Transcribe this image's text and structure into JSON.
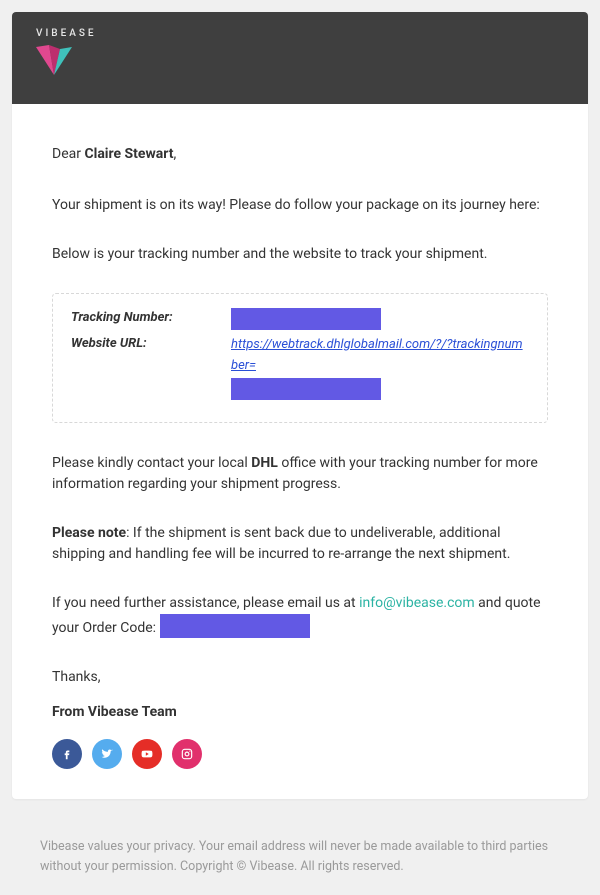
{
  "brand": {
    "name": "VIBEASE"
  },
  "greeting": {
    "prefix": "Dear ",
    "name": "Claire Stewart",
    "suffix": ","
  },
  "paragraphs": {
    "intro": "Your shipment is on its way! Please do follow your package on its journey here:",
    "tracking_intro": "Below is your tracking number and the website to track your shipment."
  },
  "tracking": {
    "number_label": "Tracking Number:",
    "url_label": "Website URL:",
    "url_text": "https://webtrack.dhlglobalmail.com/?/?trackingnumber="
  },
  "contact_dhl": {
    "pre": "Please kindly contact your local ",
    "bold": "DHL",
    "post": " office with your tracking number for more information regarding your shipment progress."
  },
  "note": {
    "label": "Please note",
    "text": ": If the shipment is sent back due to undeliverable, additional shipping and handling fee will be incurred to re-arrange the next shipment."
  },
  "assist": {
    "pre": "If you need further assistance, please email us at ",
    "email": "info@vibease.com",
    "post": " and quote your Order Code: "
  },
  "signoff": {
    "thanks": "Thanks,",
    "from": "From Vibease Team"
  },
  "socials": {
    "facebook": "facebook-icon",
    "twitter": "twitter-icon",
    "youtube": "youtube-icon",
    "instagram": "instagram-icon"
  },
  "footer": {
    "text": "Vibease values your privacy. Your email address will never be made available to third parties without your permission. Copyright © Vibease. All rights reserved."
  }
}
